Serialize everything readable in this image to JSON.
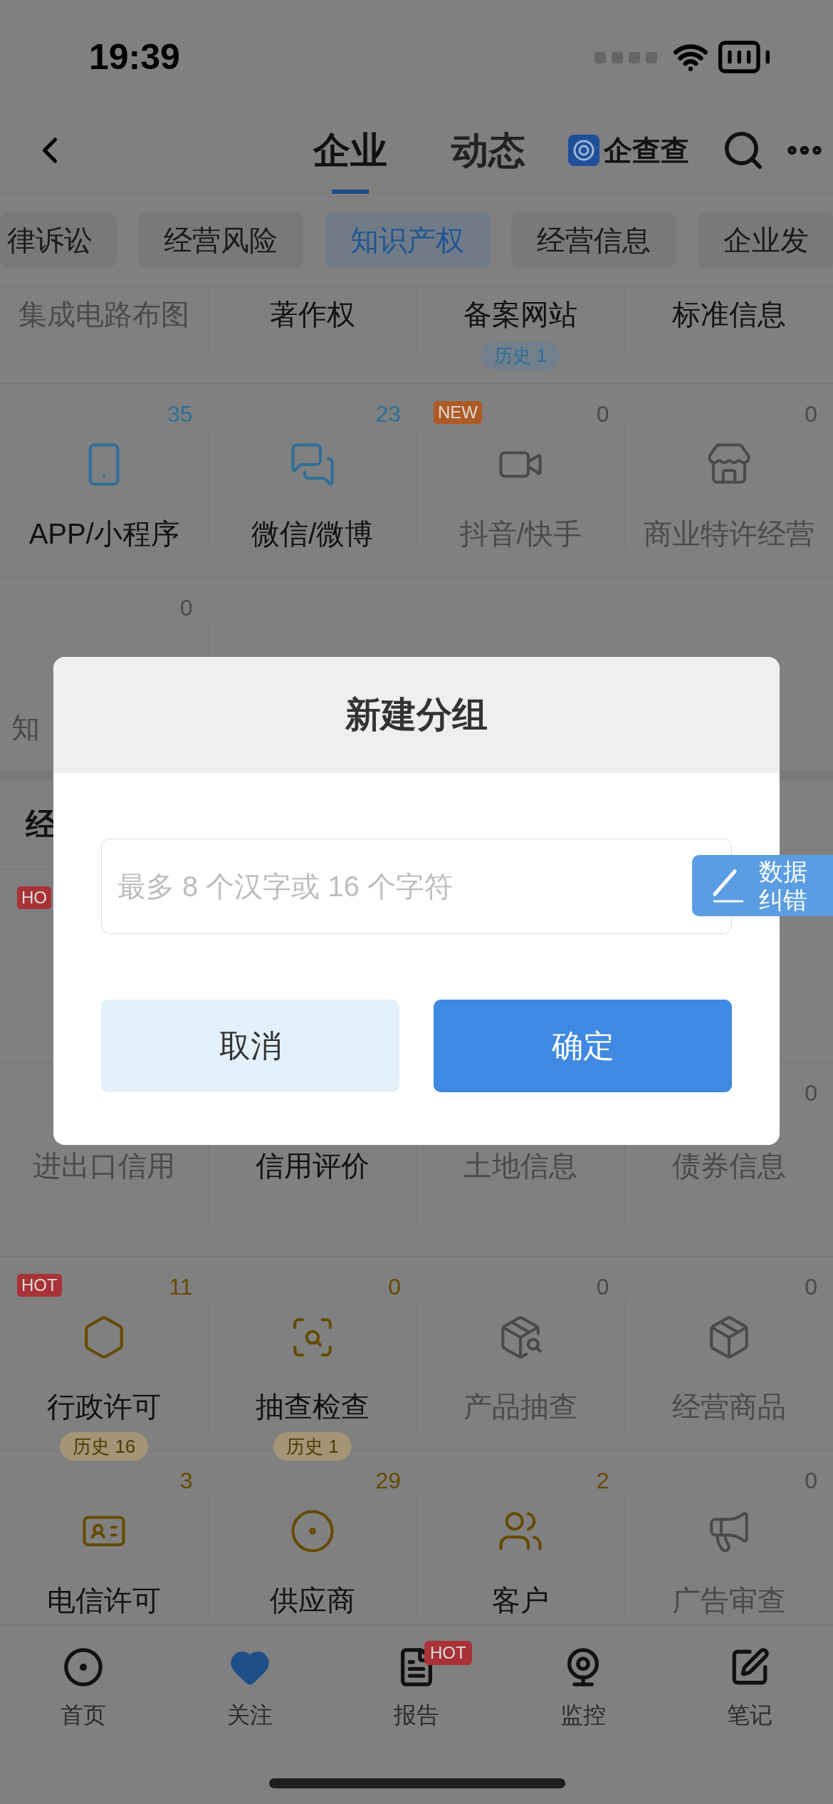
{
  "status_bar": {
    "time": "19:39"
  },
  "nav": {
    "tabs": [
      {
        "label": "企业",
        "selected": true
      },
      {
        "label": "动态",
        "selected": false
      }
    ],
    "brand": "企查查"
  },
  "chips": [
    {
      "label": "律诉讼",
      "selected": false
    },
    {
      "label": "经营风险",
      "selected": false
    },
    {
      "label": "知识产权",
      "selected": true
    },
    {
      "label": "经营信息",
      "selected": false
    },
    {
      "label": "企业发",
      "selected": false
    }
  ],
  "sections": [
    {
      "color": "#2f6f99",
      "rows": [
        {
          "kind": "compact",
          "cells": [
            {
              "label": "集成电路布图",
              "disabled": true
            },
            {
              "label": "著作权",
              "disabled": false
            },
            {
              "label": "备案网站",
              "disabled": false,
              "history": "历史 1"
            },
            {
              "label": "标准信息",
              "disabled": false
            }
          ]
        },
        {
          "kind": "full",
          "cells": [
            {
              "label": "APP/小程序",
              "count": "35",
              "disabled": false
            },
            {
              "label": "微信/微博",
              "count": "23",
              "disabled": false
            },
            {
              "label": "抖音/快手",
              "count": "0",
              "disabled": true,
              "badge": {
                "text": "NEW",
                "color": "#b05a24"
              }
            },
            {
              "label": "商业特许经营",
              "count": "0",
              "disabled": true
            }
          ]
        },
        {
          "kind": "cut",
          "cells": [
            {
              "label": "知",
              "count": "0",
              "disabled": true
            }
          ]
        }
      ]
    },
    {
      "title": "经",
      "color": "#654a00",
      "rows": [
        {
          "kind": "full",
          "cells": [
            {
              "badge": {
                "text": "HO",
                "color": "#a83236"
              }
            }
          ]
        },
        {
          "kind": "full",
          "cells": [
            {
              "label": "进出口信用",
              "disabled": true
            },
            {
              "label": "信用评价",
              "disabled": false
            },
            {
              "label": "土地信息",
              "disabled": true
            },
            {
              "label": "债券信息",
              "count": "0",
              "disabled": true
            }
          ]
        },
        {
          "kind": "full",
          "cells": [
            {
              "label": "行政许可",
              "count": "11",
              "disabled": false,
              "history": "历史 16",
              "badge": {
                "text": "HOT",
                "color": "#a83236"
              }
            },
            {
              "label": "抽查检查",
              "count": "0",
              "disabled": false,
              "history": "历史 1"
            },
            {
              "label": "产品抽查",
              "count": "0",
              "disabled": true
            },
            {
              "label": "经营商品",
              "count": "0",
              "disabled": true
            }
          ]
        },
        {
          "kind": "full",
          "cells": [
            {
              "label": "电信许可",
              "count": "3",
              "disabled": false
            },
            {
              "label": "供应商",
              "count": "29",
              "disabled": false
            },
            {
              "label": "客户",
              "count": "2",
              "disabled": false
            },
            {
              "label": "广告审查",
              "count": "0",
              "disabled": true
            }
          ]
        }
      ]
    }
  ],
  "tab_bar": [
    {
      "label": "首页",
      "selected": false
    },
    {
      "label": "关注",
      "selected": true
    },
    {
      "label": "报告",
      "selected": false,
      "badge": "HOT"
    },
    {
      "label": "监控",
      "selected": false
    },
    {
      "label": "笔记",
      "selected": false
    }
  ],
  "dialog": {
    "title": "新建分组",
    "input": {
      "placeholder": "最多 8 个汉字或 16 个字符"
    },
    "buttons": [
      {
        "label": "取消",
        "kind": "secondary"
      },
      {
        "label": "确定",
        "kind": "primary"
      }
    ]
  },
  "fab": {
    "label": "数据纠错"
  }
}
